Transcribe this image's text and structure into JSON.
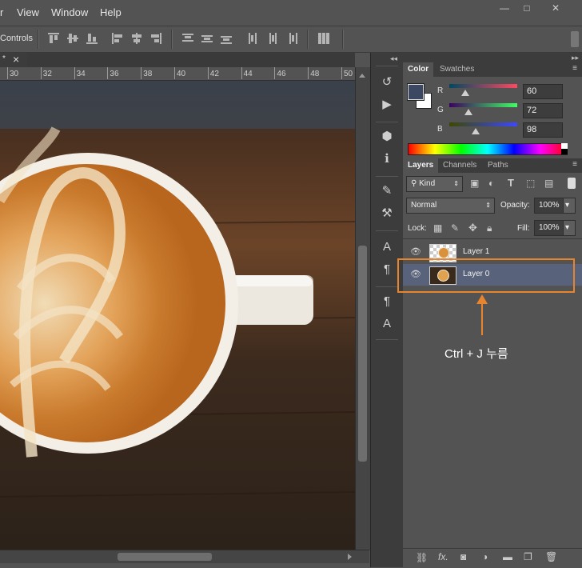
{
  "menu": {
    "r_fragment": "r",
    "view": "View",
    "window": "Window",
    "help": "Help"
  },
  "window_controls": {
    "minimize": "—",
    "maximize": "□",
    "close": "✕"
  },
  "options_bar": {
    "label": "Controls"
  },
  "doc_tab": {
    "dirty": "*",
    "close": "×"
  },
  "ruler": {
    "ticks": [
      "30",
      "32",
      "34",
      "36",
      "38",
      "40",
      "42",
      "44",
      "46",
      "48",
      "50"
    ]
  },
  "dock": {
    "collapse": "◂◂"
  },
  "color_panel": {
    "tabs": [
      "Color",
      "Swatches"
    ],
    "r_label": "R",
    "g_label": "G",
    "b_label": "B",
    "r_value": "60",
    "g_value": "72",
    "b_value": "98",
    "r_level": 0.235,
    "g_level": 0.282,
    "b_level": 0.384,
    "foreground": "#3c4862",
    "background": "#ffffff"
  },
  "layers_panel": {
    "tabs": [
      "Layers",
      "Channels",
      "Paths"
    ],
    "kind": "Kind",
    "blend": "Normal",
    "opacity_label": "Opacity:",
    "opacity_value": "100%",
    "lock_label": "Lock:",
    "fill_label": "Fill:",
    "fill_value": "100%",
    "layers": [
      {
        "name": "Layer 1"
      },
      {
        "name": "Layer 0"
      }
    ]
  },
  "annotation": {
    "text": "Ctrl + J 누름",
    "accent": "#e8852c"
  }
}
